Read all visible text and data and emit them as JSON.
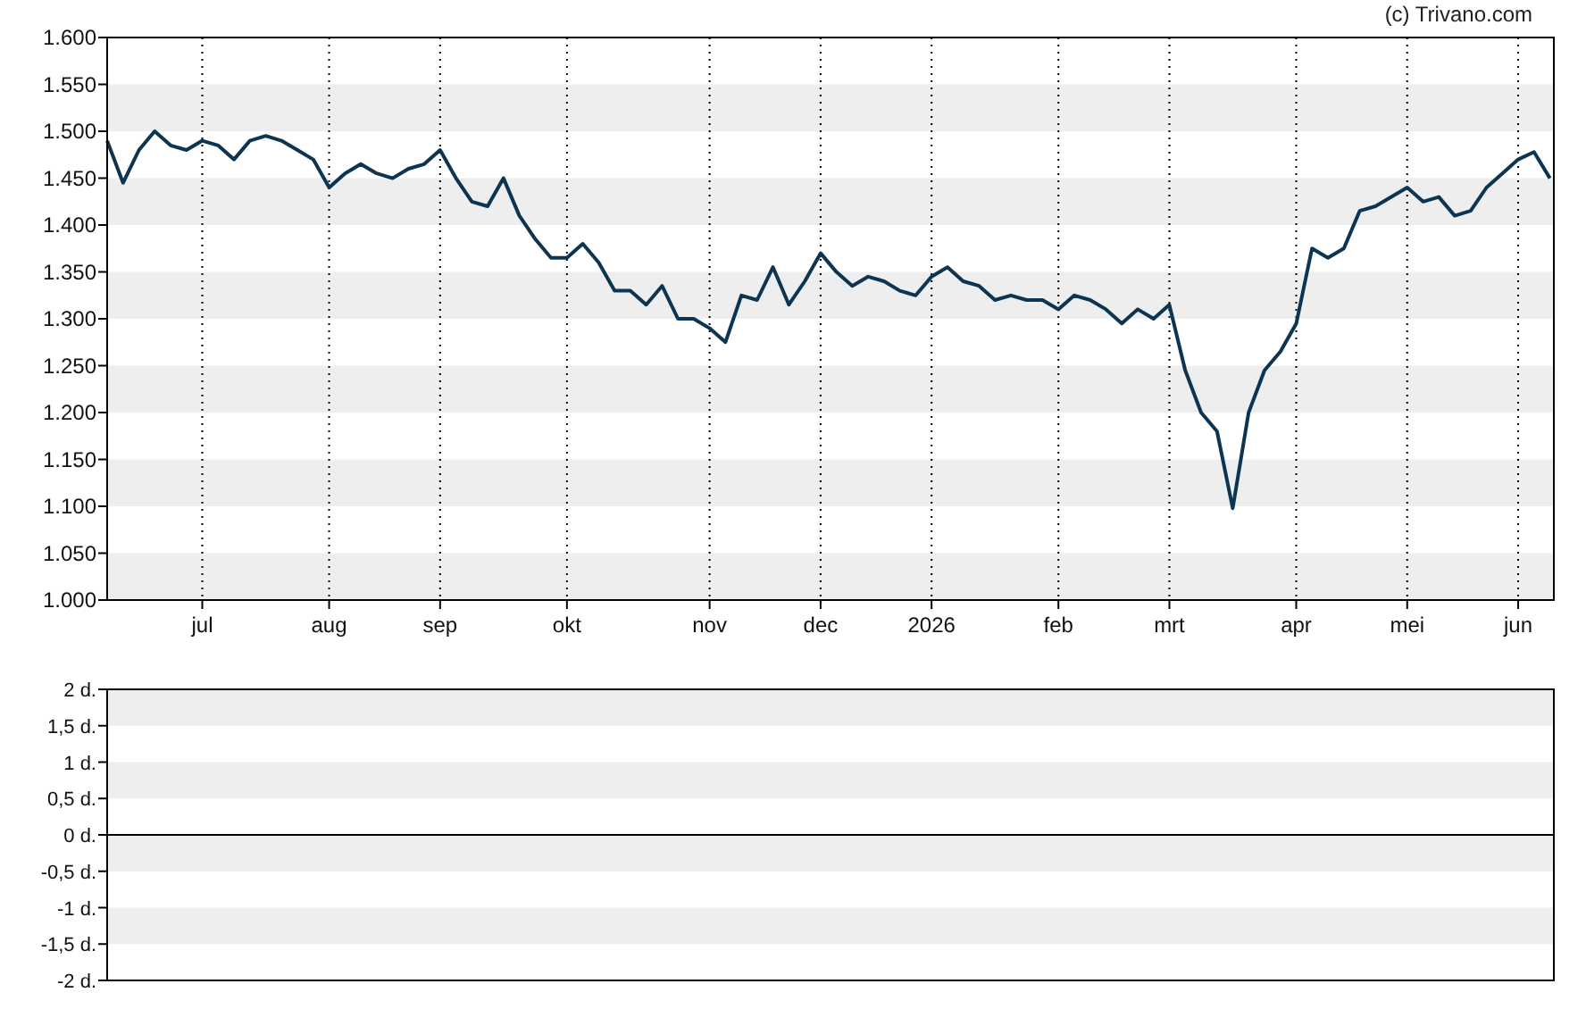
{
  "credit": "(c) Trivano.com",
  "price_chart": {
    "chart_data": {
      "type": "line",
      "grid": true,
      "ylim": [
        1000,
        1600
      ],
      "yticks": [
        {
          "value": 1000,
          "label": "1.000"
        },
        {
          "value": 1050,
          "label": "1.050"
        },
        {
          "value": 1100,
          "label": "1.100"
        },
        {
          "value": 1150,
          "label": "1.150"
        },
        {
          "value": 1200,
          "label": "1.200"
        },
        {
          "value": 1250,
          "label": "1.250"
        },
        {
          "value": 1300,
          "label": "1.300"
        },
        {
          "value": 1350,
          "label": "1.350"
        },
        {
          "value": 1400,
          "label": "1.400"
        },
        {
          "value": 1450,
          "label": "1.450"
        },
        {
          "value": 1500,
          "label": "1.500"
        },
        {
          "value": 1550,
          "label": "1.550"
        },
        {
          "value": 1600,
          "label": "1.600"
        }
      ],
      "categories": [
        null,
        null,
        null,
        null,
        null,
        null,
        "jul",
        null,
        null,
        null,
        null,
        null,
        null,
        null,
        "aug",
        null,
        null,
        null,
        null,
        null,
        null,
        "sep",
        null,
        null,
        null,
        null,
        null,
        null,
        null,
        "okt",
        null,
        null,
        null,
        null,
        null,
        null,
        null,
        null,
        "nov",
        null,
        null,
        null,
        null,
        null,
        null,
        "dec",
        null,
        null,
        null,
        null,
        null,
        null,
        "2026",
        null,
        null,
        null,
        null,
        null,
        null,
        null,
        "feb",
        null,
        null,
        null,
        null,
        null,
        null,
        "mrt",
        null,
        null,
        null,
        null,
        null,
        null,
        null,
        "apr",
        null,
        null,
        null,
        null,
        null,
        null,
        "mei",
        null,
        null,
        null,
        null,
        null,
        null,
        "jun",
        null,
        null
      ],
      "series": [
        {
          "color": "#0d3450",
          "values": [
            1490,
            1445,
            1480,
            1500,
            1485,
            1480,
            1490,
            1485,
            1470,
            1490,
            1495,
            1490,
            1480,
            1470,
            1440,
            1455,
            1465,
            1455,
            1450,
            1460,
            1465,
            1480,
            1450,
            1425,
            1420,
            1450,
            1410,
            1385,
            1365,
            1365,
            1380,
            1360,
            1330,
            1330,
            1315,
            1335,
            1300,
            1300,
            1290,
            1275,
            1325,
            1320,
            1355,
            1315,
            1340,
            1370,
            1350,
            1335,
            1345,
            1340,
            1330,
            1325,
            1345,
            1355,
            1340,
            1335,
            1320,
            1325,
            1320,
            1320,
            1310,
            1325,
            1320,
            1310,
            1295,
            1310,
            1300,
            1315,
            1245,
            1200,
            1180,
            1098,
            1200,
            1245,
            1265,
            1295,
            1375,
            1365,
            1375,
            1415,
            1420,
            1430,
            1440,
            1425,
            1430,
            1410,
            1415,
            1440,
            1455,
            1470,
            1478,
            1450
          ]
        }
      ]
    }
  },
  "days_panel": {
    "y_labels": [
      "2 d.",
      "1,5 d.",
      "1 d.",
      "0,5 d.",
      "0 d.",
      "-0,5 d.",
      "-1 d.",
      "-1,5 d.",
      "-2 d."
    ]
  }
}
